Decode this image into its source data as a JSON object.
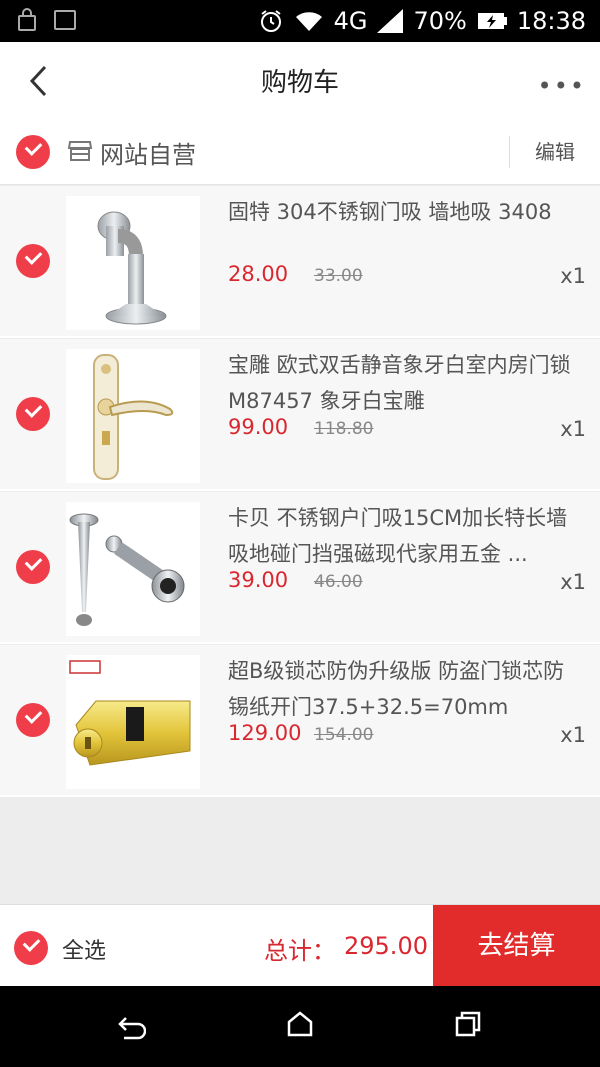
{
  "status_bar": {
    "network": "4G",
    "battery_percent": "70%",
    "time": "18:38"
  },
  "header": {
    "title": "购物车",
    "more_label": "•••"
  },
  "store": {
    "name": "网站自营",
    "edit_label": "编辑"
  },
  "items": [
    {
      "name": "固特 304不锈钢门吸 墙地吸 3408",
      "price": "28.00",
      "original_price": "33.00",
      "quantity": "x1",
      "thumb": "stainless-door-stopper"
    },
    {
      "name": "宝雕 欧式双舌静音象牙白室内房门锁M87457 象牙白宝雕",
      "price": "99.00",
      "original_price": "118.80",
      "quantity": "x1",
      "thumb": "ivory-door-lock"
    },
    {
      "name": "卡贝 不锈钢户门吸15CM加长特长墙吸地碰门挡强磁现代家用五金 ...",
      "price": "39.00",
      "original_price": "46.00",
      "quantity": "x1",
      "thumb": "long-door-stopper"
    },
    {
      "name": "超B级锁芯防伪升级版 防盗门锁芯防锡纸开门37.5+32.5=70mm",
      "price": "129.00",
      "original_price": "154.00",
      "quantity": "x1",
      "thumb": "brass-lock-cylinder"
    }
  ],
  "footer": {
    "select_all": "全选",
    "total_label": "总计：",
    "total_value": "295.00",
    "checkout_label": "去结算"
  },
  "colors": {
    "accent": "#ef3e49",
    "price": "#d9272f",
    "checkout": "#e22c2c"
  }
}
